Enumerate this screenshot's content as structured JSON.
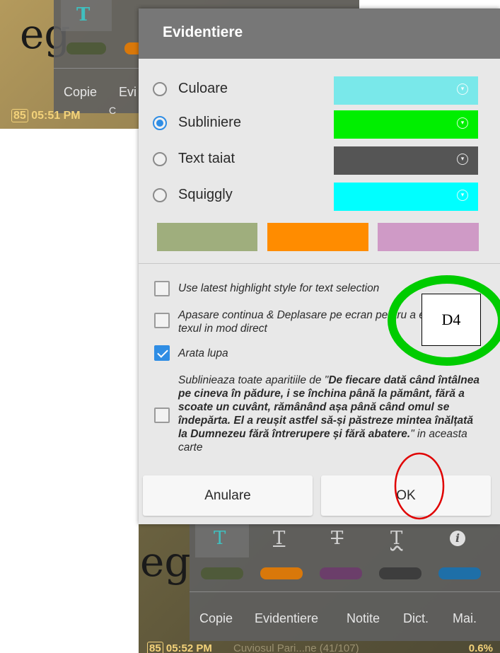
{
  "background_top": {
    "word": "eg",
    "toolbar_labels": [
      "Copie",
      "Evi",
      "C"
    ],
    "status_badge": "85",
    "status_time": "05:51 PM"
  },
  "dialog": {
    "title": "Evidentiere",
    "radio_options": [
      {
        "label": "Culoare",
        "color": "#79e8ea",
        "checked": false
      },
      {
        "label": "Subliniere",
        "color": "#00ef00",
        "checked": true
      },
      {
        "label": "Text taiat",
        "color": "#555555",
        "checked": false
      },
      {
        "label": "Squiggly",
        "color": "#00ffff",
        "checked": false
      }
    ],
    "palette_colors": [
      "#9fae7d",
      "#ff8c00",
      "#cf9ac6"
    ],
    "checkboxes": [
      {
        "label": "Use latest highlight style for text selection",
        "checked": false
      },
      {
        "label": "Apasare continua & Deplasare pe ecran pentru a evidentia texul in mod direct",
        "checked": false
      },
      {
        "label": "Arata lupa",
        "checked": true
      }
    ],
    "highlight_all": {
      "prefix": "Sublinieaza toate aparitiile de \"",
      "quote": "De fiecare dată când întâlnea pe cineva în pădure, i se închina până la pământ, fără a scoate un cuvânt, rămânând așa până când omul se îndepărta. El a reușit astfel să-și păstreze mintea înălțată la Dumnezeu fără întrerupere și fără abatere.",
      "suffix": "\" in aceasta carte",
      "checked": false
    },
    "cancel_label": "Anulare",
    "ok_label": "OK"
  },
  "background_bottom": {
    "word": "eg",
    "tool_icons": [
      "T",
      "T",
      "T",
      "T",
      "i"
    ],
    "strip_colors": [
      "#4f5a3a",
      "#d9780a",
      "#6b3e6a",
      "#3d3d3d",
      "#1e6fa8"
    ],
    "menu_items": [
      "Copie",
      "Evidentiere",
      "Notite",
      "Dict.",
      "Mai."
    ],
    "status_badge": "85",
    "status_time": "05:52 PM",
    "book_info": "Cuviosul Pari...ne (41/107)",
    "percent": "0.6%"
  },
  "annotations": {
    "marker_label": "D4",
    "green_ellipse_color": "#00cc00",
    "red_ellipse_color": "#e00000"
  }
}
